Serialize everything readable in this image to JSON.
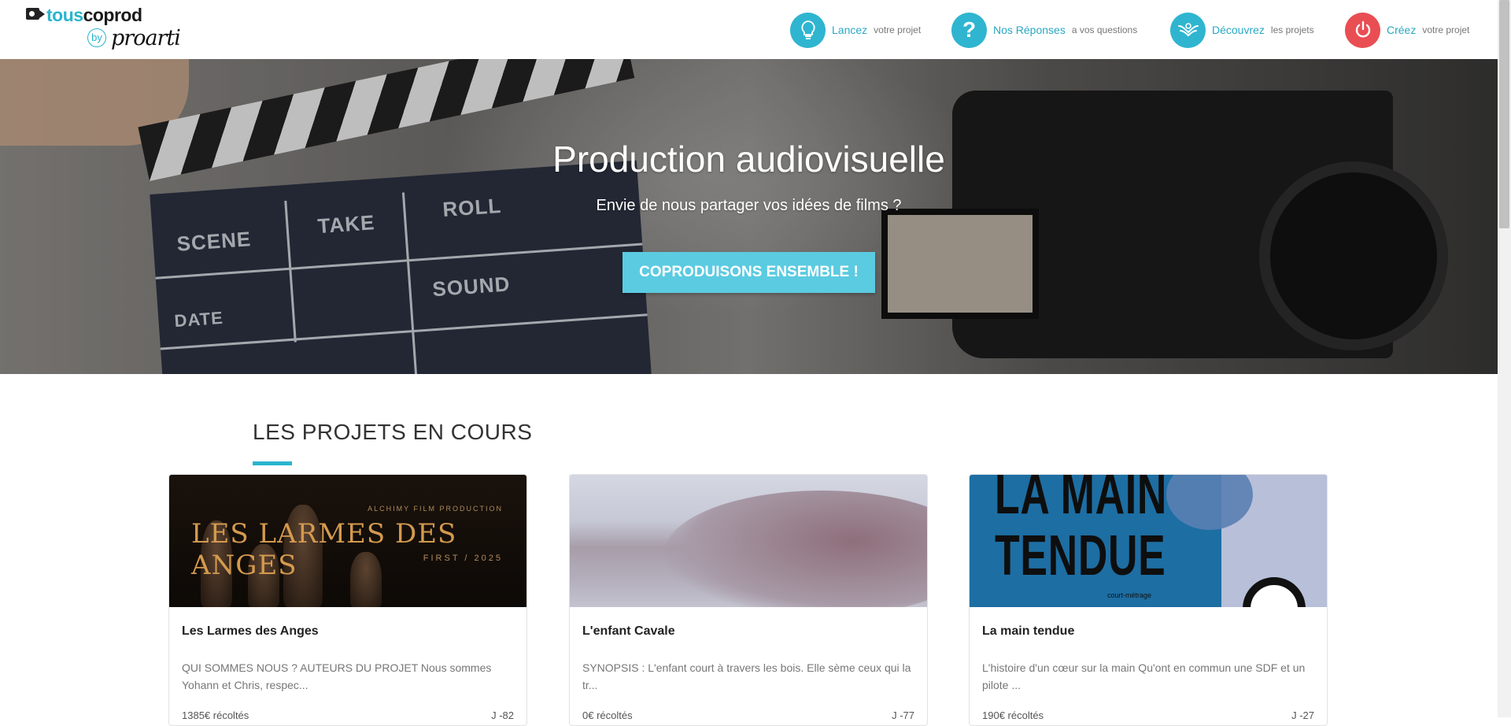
{
  "header": {
    "logo_tous": "tous",
    "logo_coprod": "coprod",
    "logo_by": "by",
    "logo_proarti": "proarti",
    "nav": [
      {
        "icon": "lightbulb-icon",
        "glyph": "💡",
        "main": "Lancez",
        "sub": "votre projet"
      },
      {
        "icon": "question-icon",
        "glyph": "?",
        "main": "Nos Réponses",
        "sub": "a vos questions"
      },
      {
        "icon": "hands-icon",
        "glyph": "🤲",
        "main": "Découvrez",
        "sub": "les projets"
      },
      {
        "icon": "power-icon",
        "glyph": "⏻",
        "main": "Créez",
        "sub": "votre projet"
      }
    ]
  },
  "hero": {
    "title": "Production audiovisuelle",
    "subtitle": "Envie de nous partager vos idées de films ?",
    "cta": "COPRODUISONS ENSEMBLE !",
    "clapper_labels": [
      "SCENE",
      "TAKE",
      "ROLL",
      "SOUND",
      "DATE"
    ]
  },
  "section": {
    "title": "LES PROJETS EN COURS"
  },
  "projects": [
    {
      "title": "Les Larmes des Anges",
      "description": "QUI SOMMES NOUS ? AUTEURS DU PROJET Nous sommes Yohann et Chris, respec...",
      "raised": "1385€ récoltés",
      "days": "J -82",
      "poster_title": "LES LARMES DES ANGES",
      "poster_studio": "ALCHIMY FILM PRODUCTION",
      "poster_year": "FIRST / 2025"
    },
    {
      "title": "L'enfant Cavale",
      "description": "SYNOPSIS : L'enfant court à travers les bois. Elle sème ceux qui la tr...",
      "raised": "0€ récoltés",
      "days": "J -77"
    },
    {
      "title": "La main tendue",
      "description": "L'histoire d'un cœur sur la main Qu'ont en commun une SDF et un pilote ...",
      "raised": "190€ récoltés",
      "days": "J -27",
      "poster_title_line1": "LA MAIN",
      "poster_title_line2": "TENDUE",
      "poster_tag": "court-métrage"
    }
  ],
  "colors": {
    "accent": "#29b5cd",
    "button": "#5bcbe1",
    "red": "#e94e53"
  }
}
